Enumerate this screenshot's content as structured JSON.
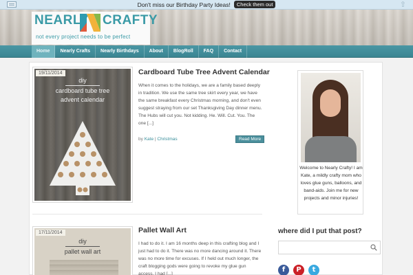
{
  "notice": {
    "text": "Don't miss our Birthday Party Ideas!",
    "button": "Check them out"
  },
  "logo": {
    "word1": "NEARLY",
    "word2": "CRAFTY",
    "tagline": "not every project needs to be perfect"
  },
  "nav": [
    "Home",
    "Nearly Crafts",
    "Nearly Birthdays",
    "About",
    "BlogRoll",
    "FAQ",
    "Contact"
  ],
  "posts": [
    {
      "date": "19/11/2014",
      "title": "Cardboard Tube Tree Advent Calendar",
      "excerpt": "When it comes to the holidays, we are a family based deeply in tradition. We use the same tree skirt every year, we have the same breakfast every Christmas morning, and don't even suggest straying from our set Thanksgiving Day dinner menu. The Hubs will cut you. Not kidding. He. Will. Cut. You. The one [...]",
      "by": "by",
      "author": "Kate",
      "sep": "|",
      "category": "Christmas",
      "read_more": "Read More",
      "image_caption": [
        "diy",
        "cardboard tube tree",
        "advent calendar"
      ]
    },
    {
      "date": "17/11/2014",
      "title": "Pallet Wall Art",
      "excerpt": "I had to do it. I am 16 months deep in this crafting blog and I just had to do it. There was no more dancing around it. There was no more time for excuses. If I held out much longer, the craft blogging gods were going to revoke my glue gun access. I had [...]",
      "image_caption": [
        "diy",
        "pallet wall art"
      ]
    }
  ],
  "sidebar": {
    "profile_text": "Welcome to Nearly Crafty! I am Kate, a mildly crafty mom who loves glue guns, balloons, and band-aids. Join me for new projects and minor injuries!",
    "search_heading": "where did I put that post?",
    "social": [
      "facebook-icon",
      "pinterest-icon",
      "twitter-icon"
    ]
  },
  "colors": {
    "teal": "#3b8692",
    "accent": "#4b8f9c"
  }
}
